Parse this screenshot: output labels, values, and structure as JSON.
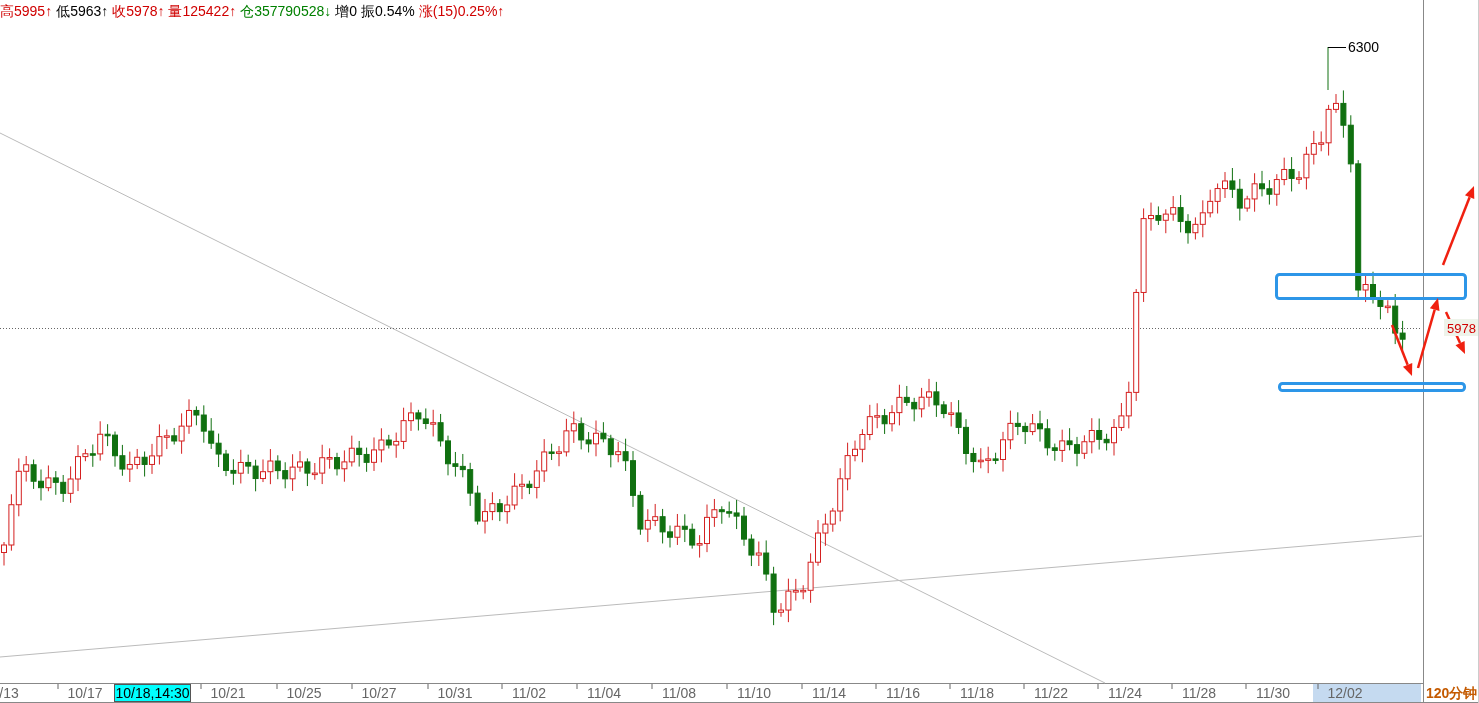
{
  "quote_bar": [
    {
      "text": "高5995↑",
      "color": "#d00000"
    },
    {
      "text": "低5963↑",
      "color": "#000000"
    },
    {
      "text": "收5978↑",
      "color": "#d00000"
    },
    {
      "text": "量125422↑",
      "color": "#d00000"
    },
    {
      "text": "仓357790528↓",
      "color": "#008000"
    },
    {
      "text": "增0",
      "color": "#000000"
    },
    {
      "text": "振0.54%",
      "color": "#000000"
    },
    {
      "text": "涨(15)0.25%↑",
      "color": "#d00000"
    }
  ],
  "chart": {
    "peak_label": "6300",
    "last_price_label": "5978"
  },
  "x_axis": {
    "labels": [
      {
        "text": "/13",
        "kind": "tick"
      },
      {
        "text": "10/17",
        "kind": "tick"
      },
      {
        "text": "10/18,14:30",
        "kind": "cursor"
      },
      {
        "text": "10/21",
        "kind": "tick"
      },
      {
        "text": "10/25",
        "kind": "tick"
      },
      {
        "text": "10/27",
        "kind": "tick"
      },
      {
        "text": "10/31",
        "kind": "tick"
      },
      {
        "text": "11/02",
        "kind": "tick"
      },
      {
        "text": "11/04",
        "kind": "tick"
      },
      {
        "text": "11/08",
        "kind": "tick"
      },
      {
        "text": "11/10",
        "kind": "tick"
      },
      {
        "text": "11/14",
        "kind": "tick"
      },
      {
        "text": "11/16",
        "kind": "tick"
      },
      {
        "text": "11/18",
        "kind": "tick"
      },
      {
        "text": "11/22",
        "kind": "tick"
      },
      {
        "text": "11/24",
        "kind": "tick"
      },
      {
        "text": "11/28",
        "kind": "tick"
      },
      {
        "text": "11/30",
        "kind": "tick"
      },
      {
        "text": "12/02",
        "kind": "range"
      }
    ],
    "period": "120分钟"
  }
}
